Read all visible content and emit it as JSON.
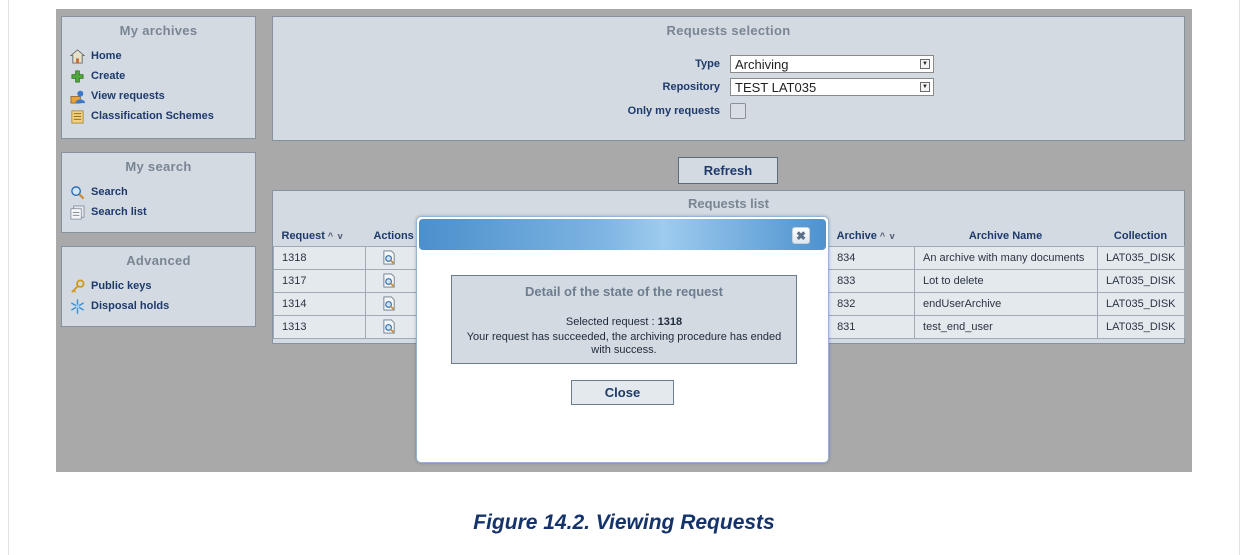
{
  "sidebar": {
    "archives": {
      "title": "My archives",
      "items": [
        {
          "label": "Home",
          "icon": "home-icon"
        },
        {
          "label": "Create",
          "icon": "plus-icon"
        },
        {
          "label": "View requests",
          "icon": "user-requests-icon"
        },
        {
          "label": "Classification Schemes",
          "icon": "scheme-icon"
        }
      ]
    },
    "search": {
      "title": "My search",
      "items": [
        {
          "label": "Search",
          "icon": "magnifier-icon"
        },
        {
          "label": "Search list",
          "icon": "list-icon"
        }
      ]
    },
    "advanced": {
      "title": "Advanced",
      "items": [
        {
          "label": "Public keys",
          "icon": "key-icon"
        },
        {
          "label": "Disposal holds",
          "icon": "snowflake-icon"
        }
      ]
    }
  },
  "selection": {
    "title": "Requests selection",
    "type_label": "Type",
    "type_value": "Archiving",
    "repository_label": "Repository",
    "repository_value": "TEST LAT035",
    "only_mine_label": "Only my requests",
    "only_mine_checked": false
  },
  "refresh_label": "Refresh",
  "requests_list": {
    "title": "Requests list",
    "headers": {
      "request": "Request",
      "actions": "Actions",
      "archive": "Archive",
      "archive_name": "Archive Name",
      "collection": "Collection"
    },
    "rows": [
      {
        "request": "1318",
        "archive": "834",
        "archive_name": "An archive with many documents",
        "collection": "LAT035_DISK"
      },
      {
        "request": "1317",
        "archive": "833",
        "archive_name": "Lot to delete",
        "collection": "LAT035_DISK"
      },
      {
        "request": "1314",
        "archive": "832",
        "archive_name": "endUserArchive",
        "collection": "LAT035_DISK"
      },
      {
        "request": "1313",
        "archive": "831",
        "archive_name": "test_end_user",
        "collection": "LAT035_DISK"
      }
    ]
  },
  "modal": {
    "close_glyph": "✖",
    "state_title": "Detail of the state of the request",
    "selected_label": "Selected request :",
    "selected_value": "1318",
    "message": "Your request has succeeded, the archiving procedure has ended with success.",
    "close_label": "Close"
  },
  "caption": "Figure 14.2. Viewing Requests",
  "colors": {
    "panel_bg": "#d3dae2",
    "overlay_bg": "#a9a9a9",
    "text_blue": "#1e3a6b",
    "modal_header": "#4b8fcc"
  }
}
